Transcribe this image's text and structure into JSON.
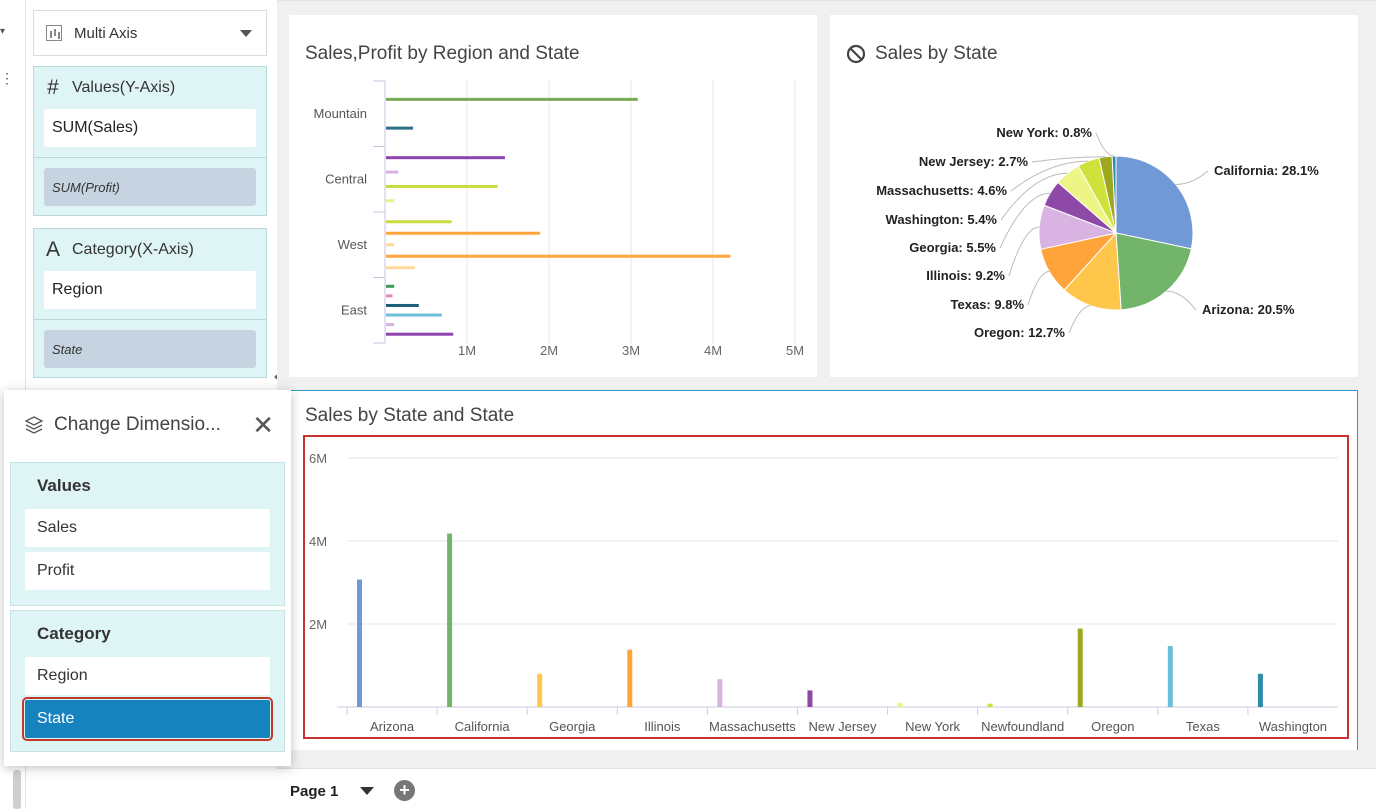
{
  "config_panel": {
    "chart_type": "Multi Axis",
    "values_header": "Values(Y-Axis)",
    "values_symbol": "#",
    "values_primary": "SUM(Sales)",
    "values_secondary": "SUM(Profit)",
    "category_header": "Category(X-Axis)",
    "category_symbol": "A",
    "category_primary": "Region",
    "category_secondary": "State"
  },
  "popup": {
    "title": "Change Dimensio...",
    "values_title": "Values",
    "values_options": [
      "Sales",
      "Profit"
    ],
    "category_title": "Category",
    "category_options": [
      "Region",
      "State"
    ],
    "selected": "State"
  },
  "page_bar": {
    "page_label": "Page 1"
  },
  "chart_data": [
    {
      "type": "bar",
      "title": "Sales,Profit by Region and State",
      "orientation": "horizontal",
      "categories": [
        "Mountain",
        "Central",
        "West",
        "East"
      ],
      "x_ticks": [
        "1M",
        "2M",
        "3M",
        "4M",
        "5M"
      ],
      "xlim": [
        0,
        5000000
      ],
      "bars": [
        {
          "category": "Mountain",
          "value": 3070000,
          "color": "#7aaa55"
        },
        {
          "category": "Mountain",
          "value": 330000,
          "color": "#2b6f8a"
        },
        {
          "category": "Central",
          "value": 1450000,
          "color": "#8e44ad"
        },
        {
          "category": "Central",
          "value": 150000,
          "color": "#d9b3e6"
        },
        {
          "category": "Central",
          "value": 1360000,
          "color": "#c8dc3c"
        },
        {
          "category": "Central",
          "value": 100000,
          "color": "#e8f08c"
        },
        {
          "category": "West",
          "value": 800000,
          "color": "#c8dc3c"
        },
        {
          "category": "West",
          "value": 1880000,
          "color": "#ffa53c"
        },
        {
          "category": "West",
          "value": 100000,
          "color": "#ffd79a"
        },
        {
          "category": "West",
          "value": 4200000,
          "color": "#ffa53c"
        },
        {
          "category": "West",
          "value": 350000,
          "color": "#ffd79a"
        },
        {
          "category": "East",
          "value": 100000,
          "color": "#3c9a5a"
        },
        {
          "category": "East",
          "value": 80000,
          "color": "#e68fb0"
        },
        {
          "category": "East",
          "value": 400000,
          "color": "#1e5d7a"
        },
        {
          "category": "East",
          "value": 680000,
          "color": "#6bbfd8"
        },
        {
          "category": "East",
          "value": 100000,
          "color": "#d9b3e6"
        },
        {
          "category": "East",
          "value": 820000,
          "color": "#8e44ad"
        }
      ]
    },
    {
      "type": "pie",
      "title": "Sales by State",
      "slices": [
        {
          "label": "California: 28.1%",
          "value": 28.1,
          "color": "#7099d6"
        },
        {
          "label": "Arizona: 20.5%",
          "value": 20.5,
          "color": "#72b56a"
        },
        {
          "label": "Oregon: 12.7%",
          "value": 12.7,
          "color": "#ffc64c"
        },
        {
          "label": "Texas: 9.8%",
          "value": 9.8,
          "color": "#ffa43a"
        },
        {
          "label": "Illinois: 9.2%",
          "value": 9.2,
          "color": "#d9b4e2"
        },
        {
          "label": "Georgia: 5.5%",
          "value": 5.5,
          "color": "#8e48a6"
        },
        {
          "label": "Washington: 5.4%",
          "value": 5.4,
          "color": "#edf586"
        },
        {
          "label": "Massachusetts: 4.6%",
          "value": 4.6,
          "color": "#cfe23c"
        },
        {
          "label": "New Jersey: 2.7%",
          "value": 2.7,
          "color": "#9da81f"
        },
        {
          "label": "New York: 0.8%",
          "value": 0.8,
          "color": "#2d8ca8"
        }
      ]
    },
    {
      "type": "bar",
      "title": "Sales by State and State",
      "categories": [
        "Arizona",
        "California",
        "Georgia",
        "Illinois",
        "Massachusetts",
        "New Jersey",
        "New York",
        "Newfoundland",
        "Oregon",
        "Texas",
        "Washington"
      ],
      "values": [
        3070000,
        4180000,
        800000,
        1380000,
        670000,
        400000,
        100000,
        80000,
        1890000,
        1470000,
        800000
      ],
      "colors": [
        "#7099d6",
        "#72b56a",
        "#ffc64c",
        "#ffa43a",
        "#d9b4e2",
        "#8e48a6",
        "#edf586",
        "#cfe23c",
        "#9da81f",
        "#6bbfd8",
        "#2d8ca8"
      ],
      "y_ticks": [
        "6M",
        "4M",
        "2M"
      ],
      "ylim": [
        0,
        6000000
      ],
      "grid": true
    }
  ]
}
